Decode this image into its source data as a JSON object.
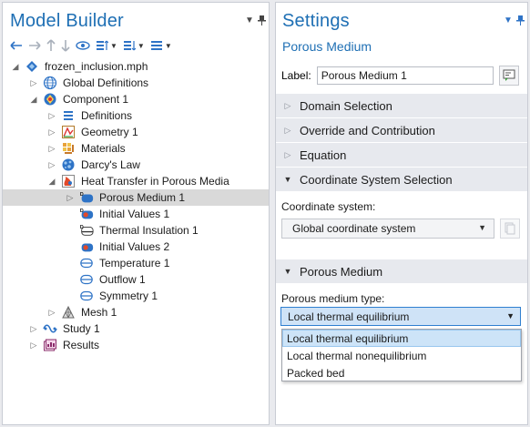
{
  "model_builder": {
    "title": "Model Builder",
    "tree": [
      {
        "label": "frozen_inclusion.mph",
        "arrow": "◢",
        "icon": "mph-file-icon",
        "indent": 0
      },
      {
        "label": "Global Definitions",
        "arrow": "▷",
        "icon": "globe-icon",
        "indent": 1
      },
      {
        "label": "Component 1",
        "arrow": "◢",
        "icon": "component-icon",
        "indent": 1
      },
      {
        "label": "Definitions",
        "arrow": "▷",
        "icon": "definitions-icon",
        "indent": 2
      },
      {
        "label": "Geometry 1",
        "arrow": "▷",
        "icon": "geometry-icon",
        "indent": 2
      },
      {
        "label": "Materials",
        "arrow": "▷",
        "icon": "materials-icon",
        "indent": 2
      },
      {
        "label": "Darcy's Law",
        "arrow": "▷",
        "icon": "darcys-law-icon",
        "indent": 2
      },
      {
        "label": "Heat Transfer in Porous Media",
        "arrow": "◢",
        "icon": "heat-transfer-icon",
        "indent": 2
      },
      {
        "label": "Porous Medium 1",
        "arrow": "▷",
        "icon": "porous-medium-icon",
        "indent": 3,
        "selected": true
      },
      {
        "label": "Initial Values 1",
        "arrow": "",
        "icon": "initial-values-icon",
        "indent": 3
      },
      {
        "label": "Thermal Insulation 1",
        "arrow": "",
        "icon": "thermal-insulation-icon",
        "indent": 3
      },
      {
        "label": "Initial Values 2",
        "arrow": "",
        "icon": "initial-values-2-icon",
        "indent": 3
      },
      {
        "label": "Temperature 1",
        "arrow": "",
        "icon": "temperature-icon",
        "indent": 3
      },
      {
        "label": "Outflow 1",
        "arrow": "",
        "icon": "outflow-icon",
        "indent": 3
      },
      {
        "label": "Symmetry 1",
        "arrow": "",
        "icon": "symmetry-icon",
        "indent": 3
      },
      {
        "label": "Mesh 1",
        "arrow": "▷",
        "icon": "mesh-icon",
        "indent": 2
      },
      {
        "label": "Study 1",
        "arrow": "▷",
        "icon": "study-icon",
        "indent": 1
      },
      {
        "label": "Results",
        "arrow": "▷",
        "icon": "results-icon",
        "indent": 1
      }
    ]
  },
  "settings": {
    "title": "Settings",
    "subtitle": "Porous Medium",
    "label_caption": "Label:",
    "label_value": "Porous Medium 1",
    "sections": {
      "domain_selection": "Domain Selection",
      "override": "Override and Contribution",
      "equation": "Equation",
      "coordinate_system_selection": "Coordinate System Selection",
      "porous_medium": "Porous Medium"
    },
    "coordinate_system_caption": "Coordinate system:",
    "coordinate_system_value": "Global coordinate system",
    "porous_medium_type_caption": "Porous medium type:",
    "porous_medium_type_value": "Local thermal equilibrium",
    "porous_medium_type_options": [
      "Local thermal equilibrium",
      "Local thermal nonequilibrium",
      "Packed bed"
    ]
  },
  "colors": {
    "title_blue": "#1e6fb4",
    "toolbar_blue": "#2e73c6",
    "selection_gray": "#d9d9d9",
    "section_bg": "#e7e9ee",
    "dropdown_highlight": "#cde4f8"
  }
}
